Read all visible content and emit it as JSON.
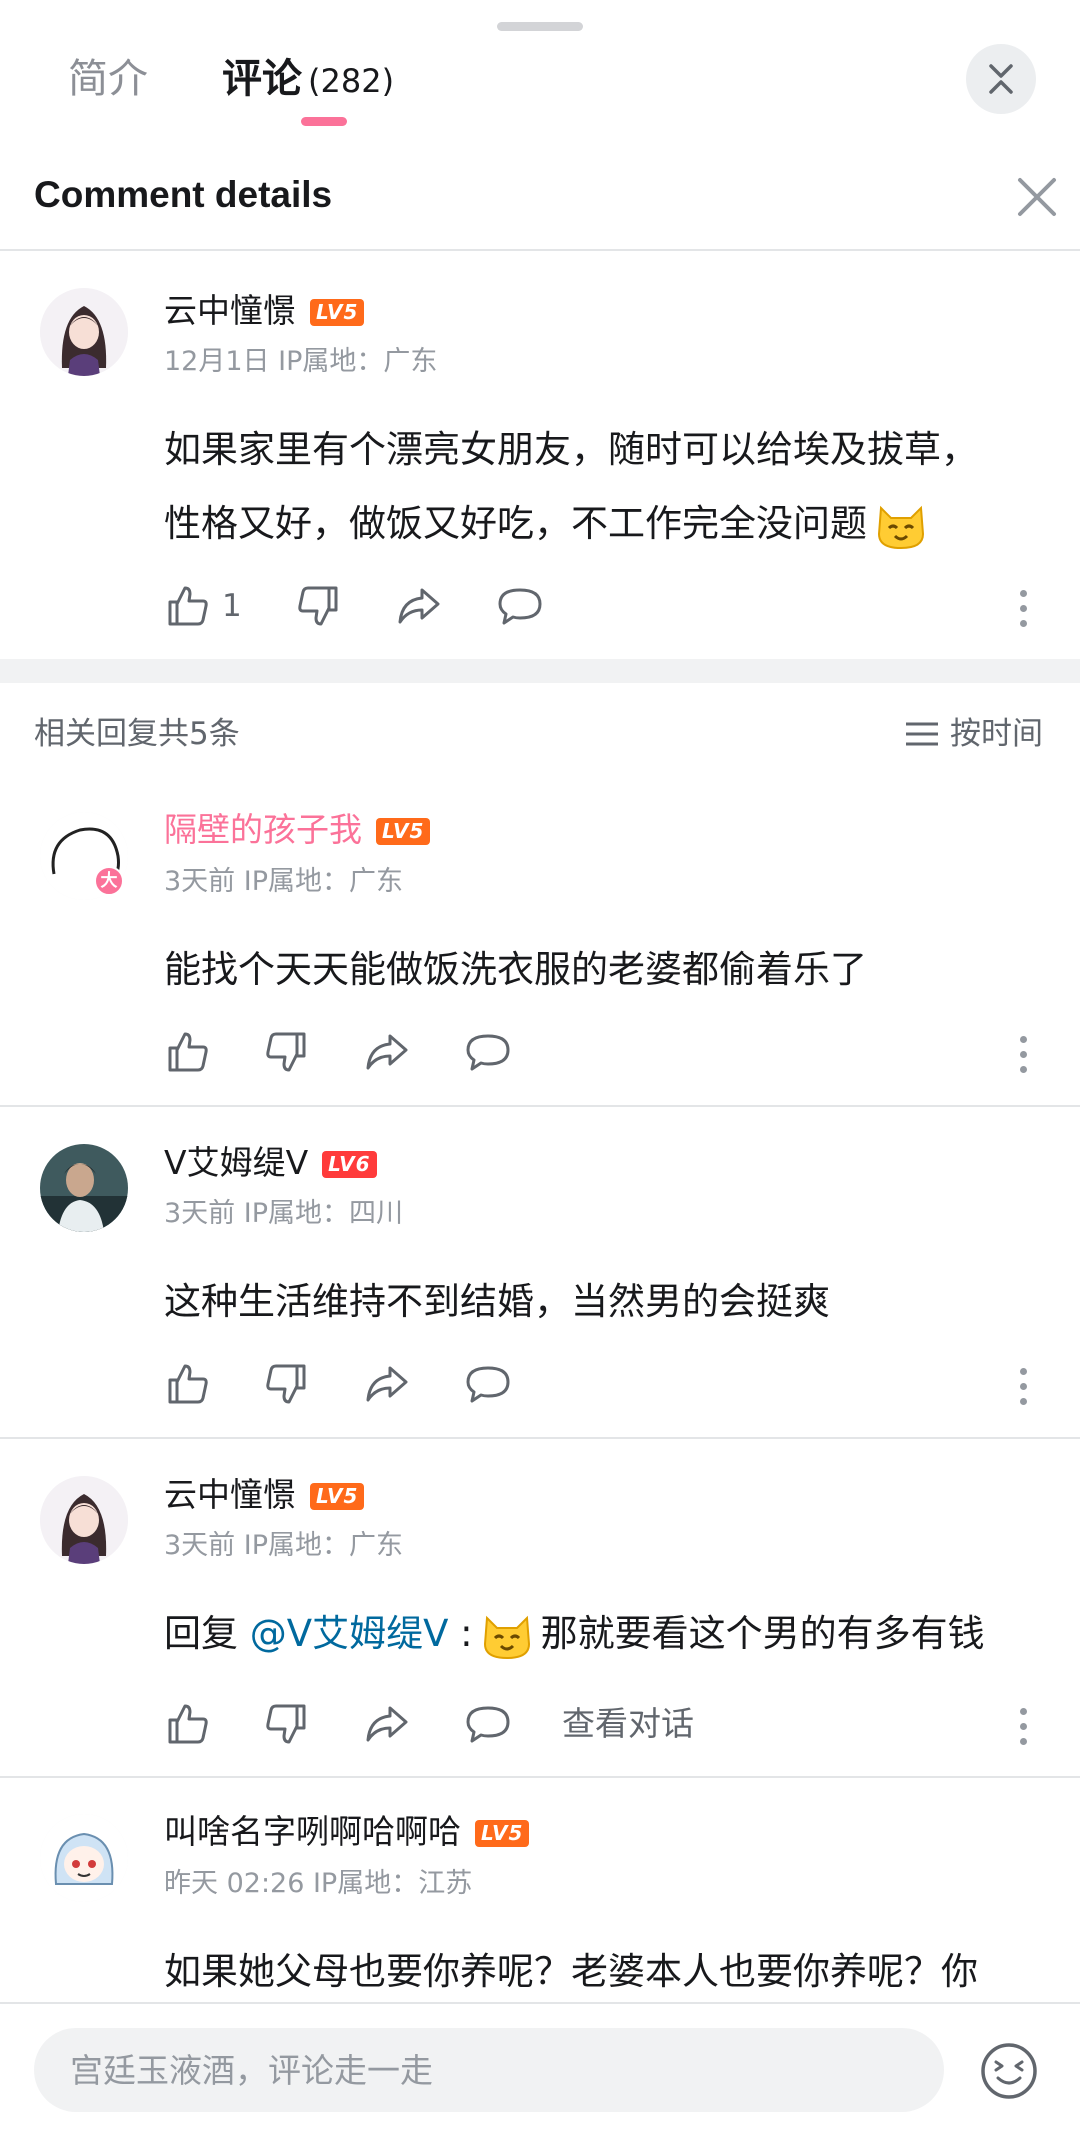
{
  "tabs": {
    "intro_label": "简介",
    "comments_label": "评论",
    "comments_count": "(282)"
  },
  "header": {
    "title": "Comment details"
  },
  "main_comment": {
    "user": "云中憧憬",
    "level": "LV5",
    "meta": "12月1日 IP属地：广东",
    "text_line1": "如果家里有个漂亮女朋友，随时可以给埃及拔草，",
    "text_line2": "性格又好，做饭又好吃，不工作完全没问题",
    "likes": "1"
  },
  "replies_header": {
    "count_label": "相关回复共5条",
    "sort_label": "按时间"
  },
  "replies": [
    {
      "user": "隔壁的孩子我",
      "level": "LV5",
      "meta": "3天前 IP属地：广东",
      "text": "能找个天天能做饭洗衣服的老婆都偷着乐了",
      "badge": "大"
    },
    {
      "user": "V艾姆缇V",
      "level": "LV6",
      "meta": "3天前 IP属地：四川",
      "text": "这种生活维持不到结婚，当然男的会挺爽"
    },
    {
      "user": "云中憧憬",
      "level": "LV5",
      "meta": "3天前 IP属地：广东",
      "reply_prefix": "回复 ",
      "mention": "@V艾姆缇V",
      "colon": " :",
      "text": "那就要看这个男的有多有钱",
      "view_conversation": "查看对话"
    },
    {
      "user": "叫啥名字咧啊哈啊哈",
      "level": "LV5",
      "meta": "昨天 02:26 IP属地：江苏",
      "text": "如果她父母也要你养呢？老婆本人也要你养呢？你"
    }
  ],
  "composer": {
    "placeholder": "宫廷玉液酒，评论走一走"
  },
  "colors": {
    "accent_pink": "#fb7299",
    "level_orange": "#ff6a1a",
    "level_red": "#ff3b3b",
    "mention_blue": "#00699e",
    "meta_gray": "#9499a0"
  },
  "icons": [
    "collapse-chevrons-icon",
    "close-icon",
    "thumbs-up-icon",
    "thumbs-down-icon",
    "share-icon",
    "reply-bubble-icon",
    "more-vertical-icon",
    "sort-lines-icon",
    "cat-emoji-icon",
    "emoji-face-icon"
  ]
}
